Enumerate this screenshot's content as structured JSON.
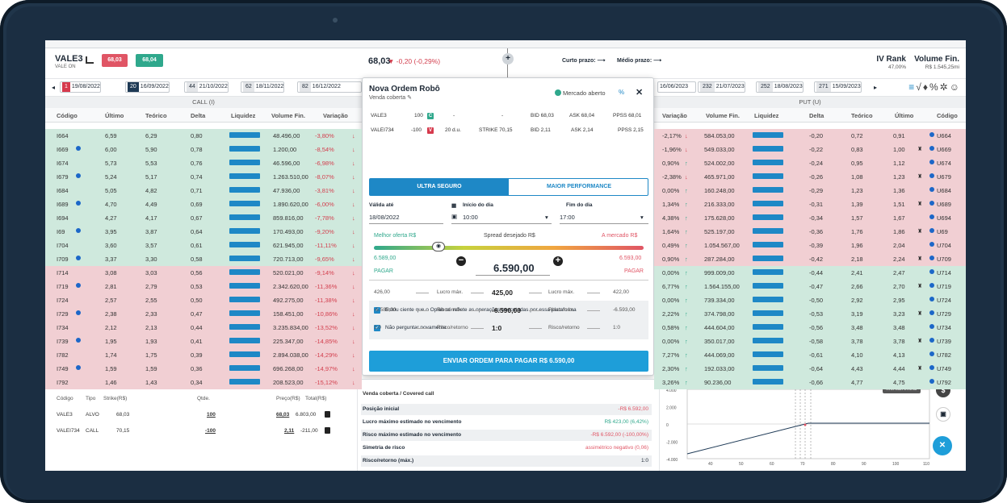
{
  "header": {
    "ticker": "VALE3",
    "ticker_sub": "VALE ON",
    "sell_btn": "68,03",
    "buy_btn": "68,04",
    "price": "68,03",
    "price_change": "▼ -0,20 (-0,29%)",
    "short_term": "Curto prazo: ⟶",
    "mid_term": "Médio prazo: ⟶",
    "iv_label": "IV Rank",
    "iv_value": "47,00%",
    "vol_label": "Volume Fin.",
    "vol_value": "R$ 1.545,25mi"
  },
  "tabs": [
    {
      "n": "1",
      "date": "19/08/2022"
    },
    {
      "n": "20",
      "date": "16/09/2022"
    },
    {
      "n": "44",
      "date": "21/10/2022"
    },
    {
      "n": "62",
      "date": "18/11/2022"
    },
    {
      "n": "82",
      "date": "16/12/2022"
    },
    {
      "n": "",
      "date": "16/06/2023"
    },
    {
      "n": "232",
      "date": "21/07/2023"
    },
    {
      "n": "252",
      "date": "18/08/2023"
    },
    {
      "n": "271",
      "date": "15/09/2023"
    }
  ],
  "call_title": "CALL (I)",
  "put_title": "PUT (U)",
  "call_cols": [
    "Código",
    "Último",
    "Teórico",
    "Delta",
    "Liquidez",
    "Volume Fin.",
    "Variação"
  ],
  "put_cols": [
    "Variação",
    "Volume Fin.",
    "Liquidez",
    "Delta",
    "Teórico",
    "Último",
    "Código"
  ],
  "call_rows": [
    [
      "I664",
      "6,59",
      "6,29",
      "0,80",
      "48.496,00",
      "-3,80%"
    ],
    [
      "I669",
      "6,00",
      "5,90",
      "0,78",
      "1.200,00",
      "-8,54%"
    ],
    [
      "I674",
      "5,73",
      "5,53",
      "0,76",
      "46.596,00",
      "-6,98%"
    ],
    [
      "I679",
      "5,24",
      "5,17",
      "0,74",
      "1.263.510,00",
      "-8,07%"
    ],
    [
      "I684",
      "5,05",
      "4,82",
      "0,71",
      "47.936,00",
      "-3,81%"
    ],
    [
      "I689",
      "4,70",
      "4,49",
      "0,69",
      "1.890.620,00",
      "-6,00%"
    ],
    [
      "I694",
      "4,27",
      "4,17",
      "0,67",
      "859.816,00",
      "-7,78%"
    ],
    [
      "I69",
      "3,95",
      "3,87",
      "0,64",
      "170.493,00",
      "-9,20%"
    ],
    [
      "I704",
      "3,60",
      "3,57",
      "0,61",
      "621.945,00",
      "-11,11%"
    ],
    [
      "I709",
      "3,37",
      "3,30",
      "0,58",
      "720.713,00",
      "-9,65%"
    ],
    [
      "I714",
      "3,08",
      "3,03",
      "0,56",
      "520.021,00",
      "-9,14%"
    ],
    [
      "I719",
      "2,81",
      "2,79",
      "0,53",
      "2.342.620,00",
      "-11,36%"
    ],
    [
      "I724",
      "2,57",
      "2,55",
      "0,50",
      "492.275,00",
      "-11,38%"
    ],
    [
      "I729",
      "2,38",
      "2,33",
      "0,47",
      "158.451,00",
      "-10,86%"
    ],
    [
      "I734",
      "2,12",
      "2,13",
      "0,44",
      "3.235.834,00",
      "-13,52%"
    ],
    [
      "I739",
      "1,95",
      "1,93",
      "0,41",
      "225.347,00",
      "-14,85%"
    ],
    [
      "I782",
      "1,74",
      "1,75",
      "0,39",
      "2.894.038,00",
      "-14,29%"
    ],
    [
      "I749",
      "1,59",
      "1,59",
      "0,36",
      "696.268,00",
      "-14,97%"
    ],
    [
      "I792",
      "1,46",
      "1,43",
      "0,34",
      "208.523,00",
      "-15,12%"
    ]
  ],
  "put_rows": [
    [
      "-2,17%",
      "584.053,00",
      "-0,20",
      "0,72",
      "0,91",
      "U664"
    ],
    [
      "-1,96%",
      "549.033,00",
      "-0,22",
      "0,83",
      "1,00",
      "U669"
    ],
    [
      "0,90%",
      "524.002,00",
      "-0,24",
      "0,95",
      "1,12",
      "U674"
    ],
    [
      "-2,38%",
      "465.971,00",
      "-0,26",
      "1,08",
      "1,23",
      "U679"
    ],
    [
      "0,00%",
      "160.248,00",
      "-0,29",
      "1,23",
      "1,36",
      "U684"
    ],
    [
      "1,34%",
      "216.333,00",
      "-0,31",
      "1,39",
      "1,51",
      "U689"
    ],
    [
      "4,38%",
      "175.628,00",
      "-0,34",
      "1,57",
      "1,67",
      "U694"
    ],
    [
      "1,64%",
      "525.197,00",
      "-0,36",
      "1,76",
      "1,86",
      "U69"
    ],
    [
      "0,49%",
      "1.054.567,00",
      "-0,39",
      "1,96",
      "2,04",
      "U704"
    ],
    [
      "0,90%",
      "287.284,00",
      "-0,42",
      "2,18",
      "2,24",
      "U709"
    ],
    [
      "0,00%",
      "999.009,00",
      "-0,44",
      "2,41",
      "2,47",
      "U714"
    ],
    [
      "6,77%",
      "1.564.155,00",
      "-0,47",
      "2,66",
      "2,70",
      "U719"
    ],
    [
      "0,00%",
      "739.334,00",
      "-0,50",
      "2,92",
      "2,95",
      "U724"
    ],
    [
      "2,22%",
      "374.798,00",
      "-0,53",
      "3,19",
      "3,23",
      "U729"
    ],
    [
      "0,58%",
      "444.604,00",
      "-0,56",
      "3,48",
      "3,48",
      "U734"
    ],
    [
      "0,00%",
      "350.017,00",
      "-0,58",
      "3,78",
      "3,78",
      "U739"
    ],
    [
      "7,27%",
      "444.069,00",
      "-0,61",
      "4,10",
      "4,13",
      "U782"
    ],
    [
      "2,30%",
      "192.033,00",
      "-0,64",
      "4,43",
      "4,44",
      "U749"
    ],
    [
      "3,26%",
      "90.236,00",
      "-0,66",
      "4,77",
      "4,75",
      "U792"
    ]
  ],
  "modal": {
    "title": "Nova Ordem Robô",
    "subtitle": "Venda coberta ✎",
    "status": "Mercado aberto",
    "pct_icon": "%",
    "legs": [
      {
        "code": "VALE3",
        "qty": "100",
        "badge": "C",
        "dte": "-",
        "strike": "-",
        "bid": "BID 68,03",
        "ask": "ASK 68,04",
        "ppss": "PPSS 68,01"
      },
      {
        "code": "VALEI734",
        "qty": "-100",
        "badge": "V",
        "dte": "20 d.u.",
        "strike": "STRIKE 70,15",
        "bid": "BID 2,11",
        "ask": "ASK 2,14",
        "ppss": "PPSS 2,15"
      }
    ],
    "tab_active": "ULTRA SEGURO",
    "tab_other": "MAIOR PERFORMANCE",
    "valid_label": "Válida até",
    "valid_value": "18/08/2022",
    "start_label": "Início do dia",
    "start_value": "10:00",
    "end_label": "Fim do dia",
    "end_value": "17:00",
    "best_label": "Melhor oferta R$",
    "spread_label": "Spread desejado R$",
    "market_label": "A mercado R$",
    "best_value": "6.589,00",
    "best_side": "PAGAR",
    "spread_value": "6.590,00",
    "market_value": "6.593,00",
    "market_side": "PAGAR",
    "stats": [
      {
        "l": "426,00",
        "label": "Lucro máx.",
        "c": "425,00",
        "label2": "Lucro máx.",
        "r": "422,00"
      },
      {
        "l": "-6.589,00",
        "label": "Risco máx.",
        "c": "-6.590,00",
        "label2": "Risco máx.",
        "r": "-6.593,00"
      },
      {
        "l": "1:0",
        "label": "Risco/retorno",
        "c": "1:0",
        "label2": "Risco/retorno",
        "r": "1:0"
      }
    ],
    "check1": "Estou ciente que o Oplab só reflete as operações executadas por essa plataforma",
    "check2": "Não perguntar novamente",
    "submit": "ENVIAR ORDEM PARA PAGAR R$ 6.590,00"
  },
  "bottom": {
    "cols": [
      "Código",
      "Tipo",
      "Strike(R$)",
      "Qtde.",
      "Preço(R$)",
      "Total(R$)"
    ],
    "rows": [
      [
        "VALE3",
        "ALVO",
        "68,03",
        "100",
        "68,03",
        "6.803,00"
      ],
      [
        "VALEI734",
        "CALL",
        "70,15",
        "-100",
        "2,11",
        "-211,00"
      ]
    ],
    "summary_title": "Venda coberta / Covered call",
    "summary": [
      {
        "k": "Posição inicial",
        "v": "-R$ 6.592,00"
      },
      {
        "k": "Lucro máximo estimado no vencimento",
        "v": "R$ 423,00 (6,42%)"
      },
      {
        "k": "Risco máximo estimado no vencimento",
        "v": "-R$ 6.592,00 (-100,00%)"
      },
      {
        "k": "Simetria de risco",
        "v": "assimétrico negativo (0,06)"
      },
      {
        "k": "Risco/retorno (máx.)",
        "v": "1:0"
      }
    ],
    "chart_y": [
      "4.000",
      "2.000",
      "0",
      "-2.000",
      "-4.000"
    ],
    "chart_x": [
      "40",
      "50",
      "60",
      "70",
      "80",
      "90",
      "100",
      "110"
    ],
    "montar": "Montar/entrar"
  }
}
